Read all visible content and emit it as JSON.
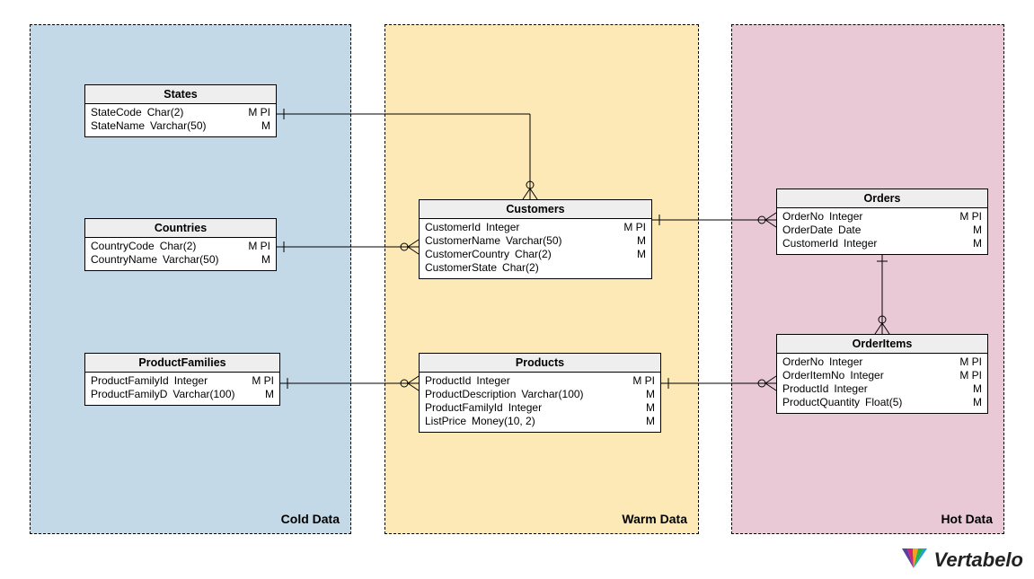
{
  "zones": {
    "cold": {
      "label": "Cold Data"
    },
    "warm": {
      "label": "Warm Data"
    },
    "hot": {
      "label": "Hot Data"
    }
  },
  "entities": {
    "states": {
      "title": "States",
      "cols": [
        {
          "name": "StateCode",
          "type": "Char(2)",
          "flags": "M PI"
        },
        {
          "name": "StateName",
          "type": "Varchar(50)",
          "flags": "M"
        }
      ]
    },
    "countries": {
      "title": "Countries",
      "cols": [
        {
          "name": "CountryCode",
          "type": "Char(2)",
          "flags": "M PI"
        },
        {
          "name": "CountryName",
          "type": "Varchar(50)",
          "flags": "M"
        }
      ]
    },
    "productfamilies": {
      "title": "ProductFamilies",
      "cols": [
        {
          "name": "ProductFamilyId",
          "type": "Integer",
          "flags": "M PI"
        },
        {
          "name": "ProductFamilyD",
          "type": "Varchar(100)",
          "flags": "M"
        }
      ]
    },
    "customers": {
      "title": "Customers",
      "cols": [
        {
          "name": "CustomerId",
          "type": "Integer",
          "flags": "M PI"
        },
        {
          "name": "CustomerName",
          "type": "Varchar(50)",
          "flags": "M"
        },
        {
          "name": "CustomerCountry",
          "type": "Char(2)",
          "flags": "M"
        },
        {
          "name": "CustomerState",
          "type": "Char(2)",
          "flags": ""
        }
      ]
    },
    "products": {
      "title": "Products",
      "cols": [
        {
          "name": "ProductId",
          "type": "Integer",
          "flags": "M PI"
        },
        {
          "name": "ProductDescription",
          "type": "Varchar(100)",
          "flags": "M"
        },
        {
          "name": "ProductFamilyId",
          "type": "Integer",
          "flags": "M"
        },
        {
          "name": "ListPrice",
          "type": "Money(10, 2)",
          "flags": "M"
        }
      ]
    },
    "orders": {
      "title": "Orders",
      "cols": [
        {
          "name": "OrderNo",
          "type": "Integer",
          "flags": "M PI"
        },
        {
          "name": "OrderDate",
          "type": "Date",
          "flags": "M"
        },
        {
          "name": "CustomerId",
          "type": "Integer",
          "flags": "M"
        }
      ]
    },
    "orderitems": {
      "title": "OrderItems",
      "cols": [
        {
          "name": "OrderNo",
          "type": "Integer",
          "flags": "M PI"
        },
        {
          "name": "OrderItemNo",
          "type": "Integer",
          "flags": "M PI"
        },
        {
          "name": "ProductId",
          "type": "Integer",
          "flags": "M"
        },
        {
          "name": "ProductQuantity",
          "type": "Float(5)",
          "flags": "M"
        }
      ]
    }
  },
  "logo": {
    "text": "Vertabelo"
  }
}
